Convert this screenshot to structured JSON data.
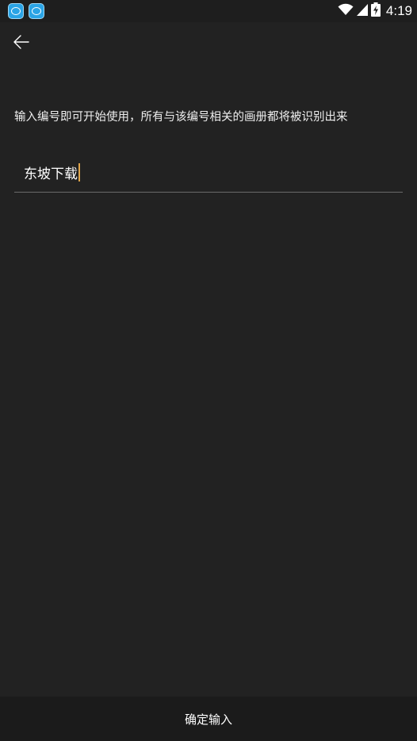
{
  "status_bar": {
    "time": "4:19",
    "notification_icons": [
      "app-notification-icon",
      "app-notification-icon"
    ],
    "indicators": [
      "wifi-icon",
      "signal-icon",
      "battery-charging-icon"
    ]
  },
  "header": {
    "back_icon": "back-arrow-icon"
  },
  "main": {
    "instruction": "输入编号即可开始使用，所有与该编号相关的画册都将被识别出来",
    "input_value": "东坡下载"
  },
  "footer": {
    "confirm_label": "确定输入"
  },
  "colors": {
    "background": "#222222",
    "caret": "#e0a54a",
    "underline": "#6a6a6a",
    "notification_icon": "#2aa4e6"
  }
}
